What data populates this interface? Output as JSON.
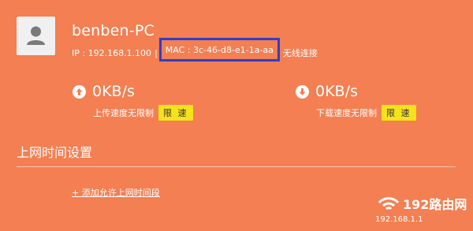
{
  "device": {
    "name": "benben-PC",
    "ip_label": "IP : 192.168.1.100",
    "separator": "|",
    "mac_label": "MAC : 3c-46-d8-e1-1a-aa",
    "connection": "无线连接"
  },
  "upload": {
    "speed": "0KB/s",
    "status": "上传速度无限制",
    "limit_button": "限 速"
  },
  "download": {
    "speed": "0KB/s",
    "status": "下载速度无限制",
    "limit_button": "限 速"
  },
  "schedule": {
    "title": "上网时间设置",
    "add_link": "+ 添加允许上网时间段"
  },
  "watermark": {
    "brand": "192路由网",
    "url": "192.168.1.1"
  },
  "colors": {
    "background": "#f37f52",
    "highlight_box": "#2f3fc8",
    "limit_button": "#f6e21b"
  }
}
